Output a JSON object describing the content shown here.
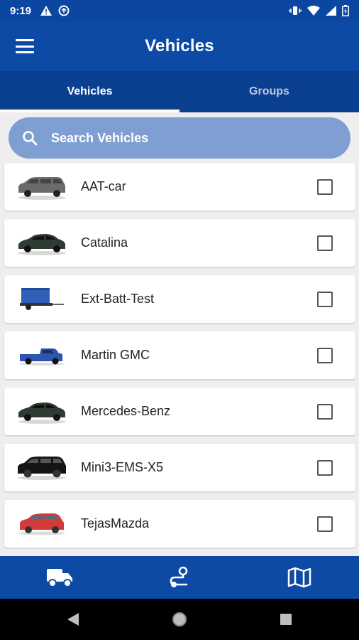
{
  "status_bar": {
    "time": "9:19"
  },
  "app_bar": {
    "title": "Vehicles"
  },
  "tabs": [
    {
      "label": "Vehicles",
      "active": true
    },
    {
      "label": "Groups",
      "active": false
    }
  ],
  "search": {
    "placeholder": "Search Vehicles"
  },
  "vehicles": [
    {
      "name": "AAT-car",
      "icon": "suv-gray-icon",
      "color": "#6b6b6b"
    },
    {
      "name": "Catalina",
      "icon": "sedan-dark-icon",
      "color": "#2e3b33"
    },
    {
      "name": "Ext-Batt-Test",
      "icon": "trailer-blue-icon",
      "color": "#2f5fb8"
    },
    {
      "name": "Martin GMC",
      "icon": "pickup-blue-icon",
      "color": "#2d55b0"
    },
    {
      "name": "Mercedes-Benz",
      "icon": "sedan-dark-icon",
      "color": "#2e3b33"
    },
    {
      "name": "Mini3-EMS-X5",
      "icon": "suv-black-icon",
      "color": "#151515"
    },
    {
      "name": "TejasMazda",
      "icon": "hatchback-red-icon",
      "color": "#d33b3b"
    }
  ],
  "bottom_nav": [
    "truck-icon",
    "route-icon",
    "map-icon"
  ],
  "colors": {
    "primary": "#0d4aa6",
    "tab_bar": "#0b3f8f",
    "search_bg": "#7f9fd3"
  }
}
